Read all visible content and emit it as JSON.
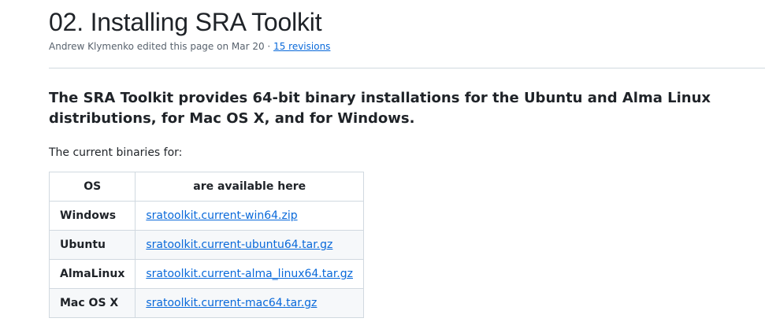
{
  "header": {
    "title": "02. Installing SRA Toolkit",
    "meta_prefix": "Andrew Klymenko edited this page on Mar 20 · ",
    "revisions_link": "15 revisions"
  },
  "content": {
    "lead": "The SRA Toolkit provides 64-bit binary installations for the Ubuntu and Alma Linux distributions, for Mac OS X, and for Windows.",
    "subheading": "The current binaries for:"
  },
  "table": {
    "headers": [
      "OS",
      "are available here"
    ],
    "rows": [
      {
        "os": "Windows",
        "link": "sratoolkit.current-win64.zip"
      },
      {
        "os": "Ubuntu",
        "link": "sratoolkit.current-ubuntu64.tar.gz"
      },
      {
        "os": "AlmaLinux",
        "link": "sratoolkit.current-alma_linux64.tar.gz"
      },
      {
        "os": "Mac OS X",
        "link": "sratoolkit.current-mac64.tar.gz"
      }
    ]
  },
  "colors": {
    "link": "#0969da",
    "text": "#1f2328",
    "muted": "#59636e",
    "border": "#d1d9e0",
    "stripe": "#f6f8fa"
  }
}
